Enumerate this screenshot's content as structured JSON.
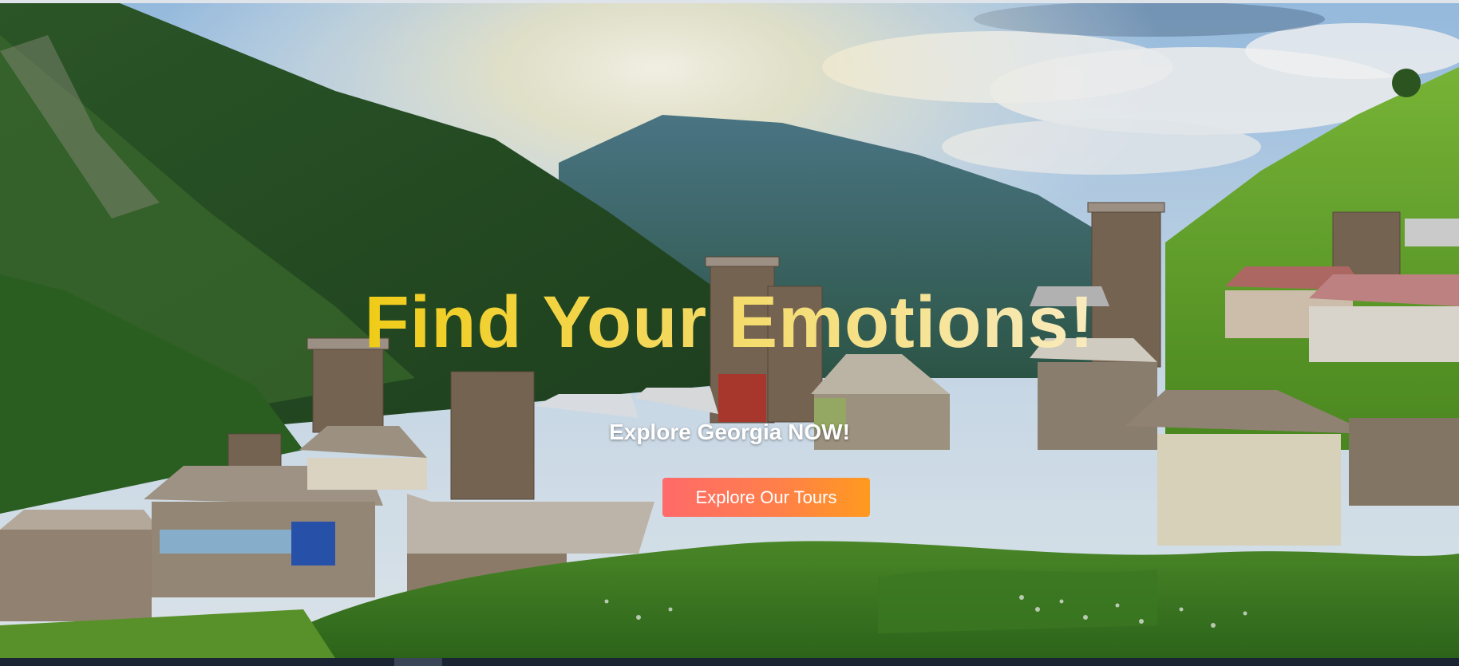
{
  "hero": {
    "title": "Find Your Emotions!",
    "subtitle": "Explore Georgia NOW!",
    "cta_label": "Explore Our Tours",
    "colors": {
      "title_gradient_start": "#f7d21a",
      "title_gradient_end": "#fff3c9",
      "cta_gradient_start": "#ff6a6a",
      "cta_gradient_end": "#ff9a1f"
    }
  },
  "footer_bar": {
    "corner_text": "",
    "bar_color": "#1b2433"
  }
}
